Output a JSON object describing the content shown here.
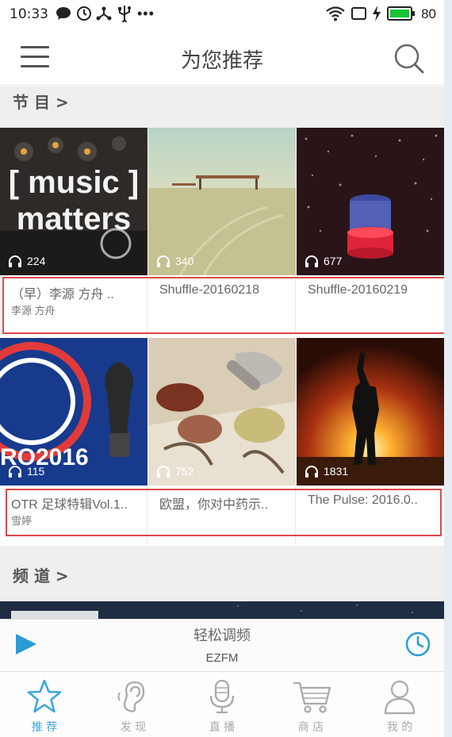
{
  "status_bar": {
    "time": "10:33",
    "battery": "80",
    "icons": [
      "message-icon",
      "alarm-icon",
      "usb-share-icon",
      "usb-icon",
      "more-dots-icon",
      "wifi-icon",
      "screen-icon",
      "charging-icon",
      "battery-icon"
    ],
    "battery_color": "#19c339"
  },
  "header": {
    "title": "为您推荐",
    "menu_icon": "hamburger-menu-icon",
    "search_icon": "search-icon"
  },
  "sections": {
    "programs": "节 目 >",
    "channels": "频 道 >"
  },
  "programs": [
    {
      "title": "（早）李源 方舟 ..",
      "author": "李源 方舟",
      "plays": "224",
      "image_text_1": "[ music ]",
      "image_text_2": "matters"
    },
    {
      "title": "Shuffle-20160218",
      "author": "",
      "plays": "340"
    },
    {
      "title": "Shuffle-20160219",
      "author": "",
      "plays": "677"
    },
    {
      "title": "OTR 足球特辑Vol.1..",
      "author": "雪婷",
      "plays": "115",
      "image_text_1": "RO2016"
    },
    {
      "title": "欧盟，你对中药示..",
      "author": "",
      "plays": "752"
    },
    {
      "title": "The Pulse: 2016.0..",
      "author": "",
      "plays": "1831"
    }
  ],
  "player": {
    "station_name": "轻松调频",
    "station_code": "EZFM",
    "accent_color": "#2a9bd6"
  },
  "bottom_nav": [
    {
      "label": "推 荐",
      "icon": "star-icon",
      "active": true
    },
    {
      "label": "发 现",
      "icon": "ear-icon",
      "active": false
    },
    {
      "label": "直 播",
      "icon": "microphone-icon",
      "active": false
    },
    {
      "label": "商 店",
      "icon": "shopping-cart-icon",
      "active": false
    },
    {
      "label": "我 的",
      "icon": "user-icon",
      "active": false
    }
  ]
}
